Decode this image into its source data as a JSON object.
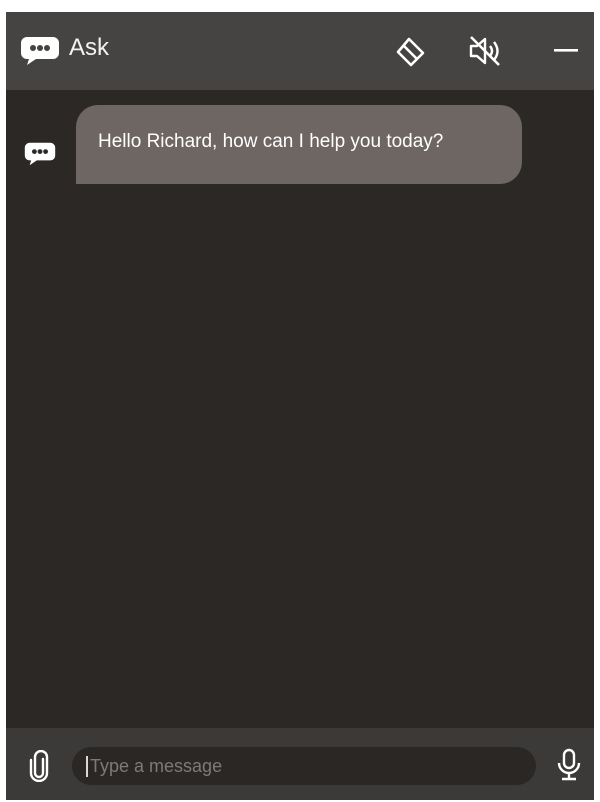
{
  "header": {
    "title": "Ask",
    "icons": [
      "chat-bubble-icon",
      "eraser-icon",
      "speaker-muted-icon",
      "minimize-icon"
    ]
  },
  "chat": {
    "messages": [
      {
        "sender": "bot",
        "avatar_icon": "chat-bubble-icon",
        "text": "Hello Richard, how can I help you today?"
      }
    ]
  },
  "footer": {
    "attach_icon": "paperclip-icon",
    "input_placeholder": "Type a message",
    "input_value": "",
    "mic_icon": "microphone-icon"
  },
  "colors": {
    "header_bg": "#464442",
    "chat_bg": "#2b2826",
    "bubble_bg": "#6d6662",
    "footer_bg": "#3c3a38",
    "input_bg": "#2a2725",
    "text": "#ffffff"
  }
}
